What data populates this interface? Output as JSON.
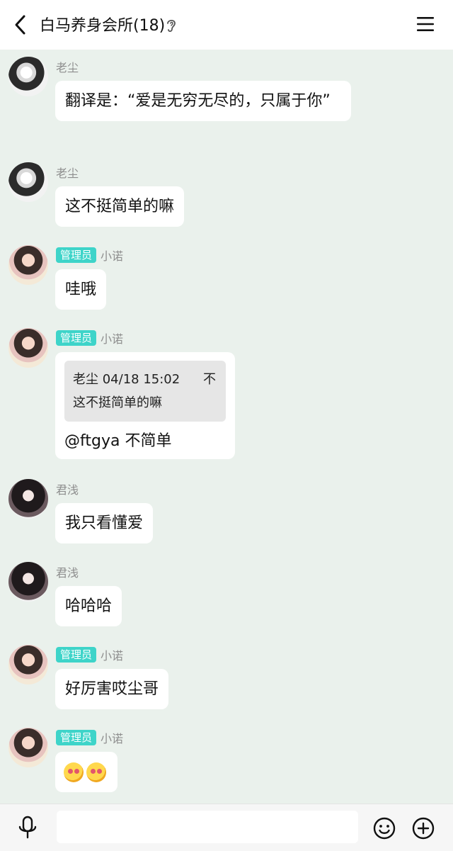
{
  "header": {
    "title": "白马养身会所(18)",
    "back_icon": "chevron-left-icon",
    "ear_icon": "ear-icon",
    "menu_icon": "hamburger-menu-icon"
  },
  "messages": [
    {
      "name": "老尘",
      "badge": "",
      "text": "翻译是：“爱是无穷无尽的，只属于你”"
    },
    {
      "name": "老尘",
      "badge": "",
      "text": "这不挺简单的嘛"
    },
    {
      "name": "小诺",
      "badge": "管理员",
      "text": "哇哦"
    },
    {
      "name": "小诺",
      "badge": "管理员",
      "quote": {
        "header": "老尘 04/18 15:02",
        "text": "这不挺简单的嘛",
        "close": "不"
      },
      "text": "@ftgya 不简单"
    },
    {
      "name": "君浅",
      "badge": "",
      "text": "我只看懂爱"
    },
    {
      "name": "君浅",
      "badge": "",
      "text": "哈哈哈"
    },
    {
      "name": "小诺",
      "badge": "管理员",
      "text": "好厉害哎尘哥"
    },
    {
      "name": "小诺",
      "badge": "管理员",
      "emojis": [
        "heart-eyes-emoji",
        "heart-eyes-emoji"
      ]
    }
  ],
  "input_bar": {
    "placeholder": "",
    "mic_icon": "microphone-icon",
    "emoji_icon": "smiley-icon",
    "plus_icon": "plus-circle-icon"
  },
  "colors": {
    "background": "#eaf1ec",
    "badge": "#3ed4c9",
    "bubble": "#ffffff"
  }
}
